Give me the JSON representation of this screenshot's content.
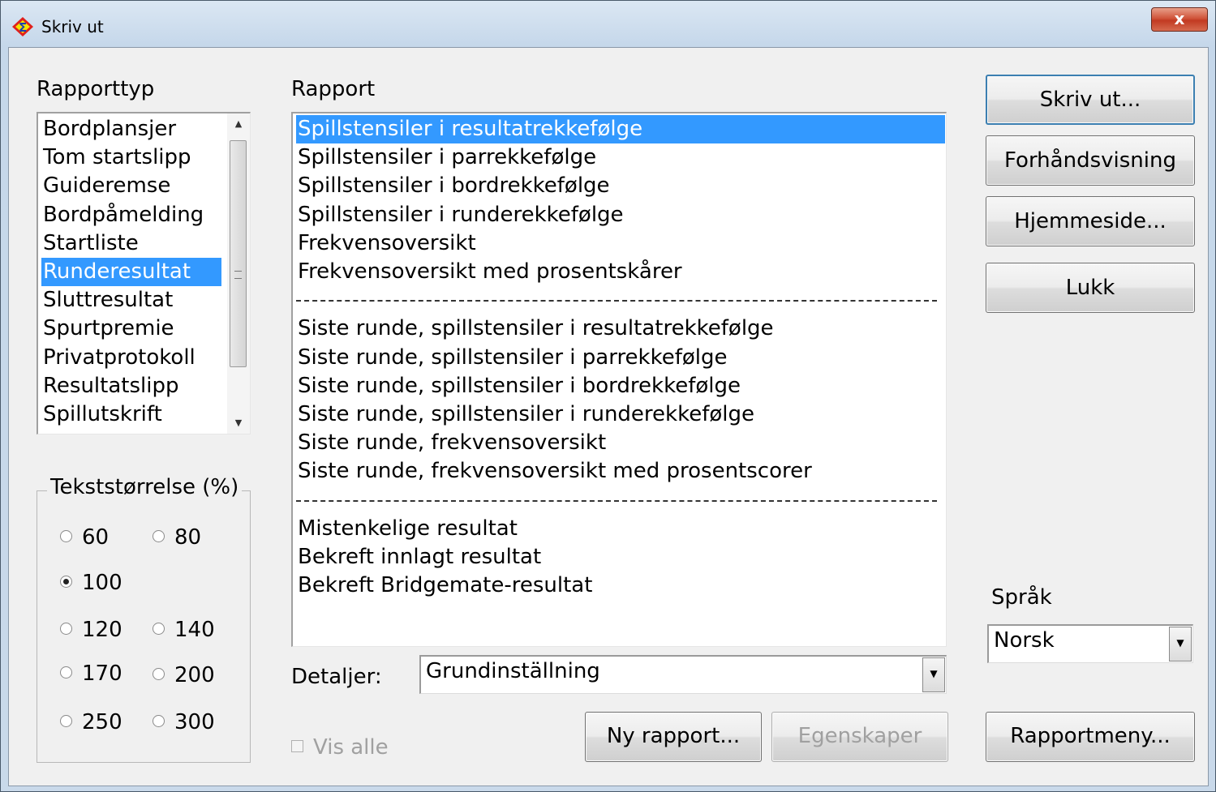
{
  "window": {
    "title": "Skriv ut",
    "close_label": "x"
  },
  "rapporttyp": {
    "label": "Rapporttyp",
    "items": [
      "Bordplansjer",
      "Tom startslipp",
      "Guideremse",
      "Bordpåmelding",
      "Startliste",
      "Runderesultat",
      "Sluttresultat",
      "Spurtpremie",
      "Privatprotokoll",
      "Resultatslipp",
      "Spillutskrift"
    ],
    "selected": "Runderesultat"
  },
  "rapport": {
    "label": "Rapport",
    "groups": [
      [
        "Spillstensiler i resultatrekkefølge",
        "Spillstensiler i parrekkefølge",
        "Spillstensiler i bordrekkefølge",
        "Spillstensiler i runderekkefølge",
        "Frekvensoversikt",
        "Frekvensoversikt med prosentskårer"
      ],
      [
        "Siste runde, spillstensiler i resultatrekkefølge",
        "Siste runde, spillstensiler i parrekkefølge",
        "Siste runde, spillstensiler i bordrekkefølge",
        "Siste runde, spillstensiler i runderekkefølge",
        "Siste runde, frekvensoversikt",
        "Siste runde, frekvensoversikt med prosentscorer"
      ],
      [
        "Mistenkelige resultat",
        "Bekreft innlagt resultat",
        "Bekreft Bridgemate-resultat"
      ]
    ],
    "selected": "Spillstensiler i resultatrekkefølge"
  },
  "tekststorrelse": {
    "label": "Tekststørrelse (%)",
    "options": [
      "60",
      "80",
      "100",
      "120",
      "140",
      "170",
      "200",
      "250",
      "300"
    ],
    "selected": "100"
  },
  "detaljer": {
    "label": "Detaljer:",
    "value": "Grundinställning"
  },
  "vis_alle": {
    "label": "Vis alle",
    "checked": false,
    "enabled": false
  },
  "buttons": {
    "skriv_ut": "Skriv ut...",
    "forhandsvisning": "Forhåndsvisning",
    "hjemmeside": "Hjemmeside...",
    "lukk": "Lukk",
    "ny_rapport": "Ny rapport...",
    "egenskaper": "Egenskaper",
    "rapportmeny": "Rapportmeny..."
  },
  "sprak": {
    "label": "Språk",
    "value": "Norsk"
  }
}
